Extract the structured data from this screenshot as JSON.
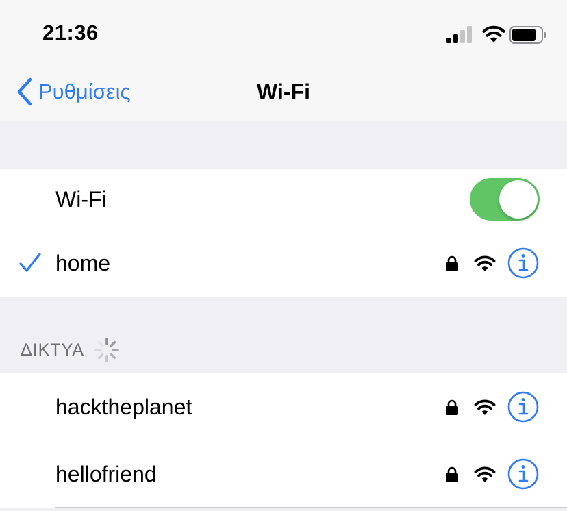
{
  "status_bar": {
    "time": "21:36",
    "signal_icon": "cellular-signal-icon",
    "wifi_icon": "wifi-icon",
    "battery_icon": "battery-icon"
  },
  "nav": {
    "back_label": "Ρυθμίσεις",
    "title": "Wi-Fi"
  },
  "wifi_group": {
    "toggle_label": "Wi-Fi",
    "toggle_on": true,
    "connected_network": "home"
  },
  "networks_section": {
    "header": "ΔΙΚΤΥΑ",
    "networks": [
      {
        "name": "hacktheplanet",
        "secured": true
      },
      {
        "name": "hellofriend",
        "secured": true
      }
    ]
  },
  "colors": {
    "accent": "#2f7cf6",
    "toggle_on": "#5fc565",
    "background": "#efeff4"
  }
}
